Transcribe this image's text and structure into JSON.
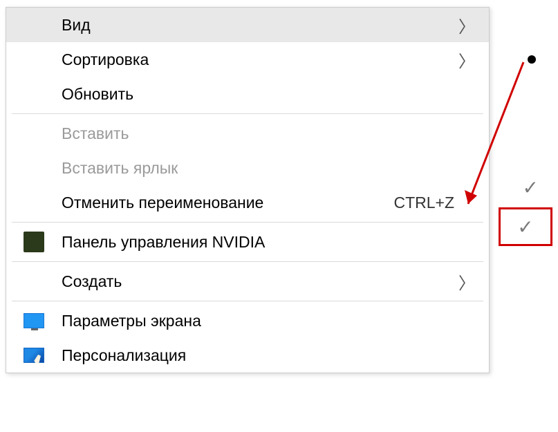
{
  "menu": {
    "view": {
      "label": "Вид"
    },
    "sort": {
      "label": "Сортировка"
    },
    "refresh": {
      "label": "Обновить"
    },
    "paste": {
      "label": "Вставить"
    },
    "paste_shortcut": {
      "label": "Вставить ярлык"
    },
    "undo_rename": {
      "label": "Отменить переименование",
      "shortcut": "CTRL+Z"
    },
    "nvidia": {
      "label": "Панель управления NVIDIA"
    },
    "new": {
      "label": "Создать"
    },
    "display_settings": {
      "label": "Параметры экрана"
    },
    "personalize": {
      "label": "Персонализация"
    }
  },
  "side": {
    "check1": "✓",
    "check2": "✓"
  }
}
